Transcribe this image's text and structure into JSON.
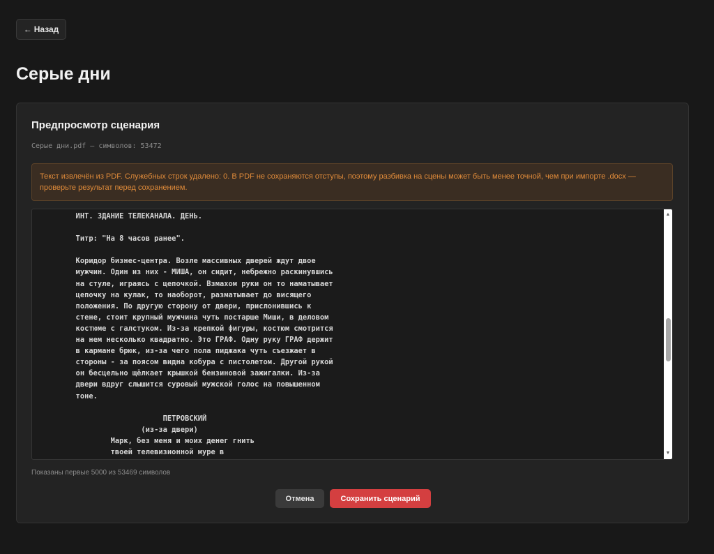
{
  "nav": {
    "back_arrow": "←",
    "back_label": "Назад",
    "back_icon": "arrow-left-icon"
  },
  "page": {
    "title": "Серые дни"
  },
  "preview": {
    "title": "Предпросмотр сценария",
    "file_info": "Серые дни.pdf — символов: 53472",
    "warning": "Текст извлечён из PDF. Служебных строк удалено: 0. В PDF не сохраняются отступы, поэтому разбивка на сцены может быть менее точной, чем при импорте .docx — проверьте результат перед сохранением.",
    "text": "          ИНТ. ЗДАНИЕ ТЕЛЕКАНАЛА. ДЕНЬ.\n\n          Титр: \"На 8 часов ранее\".\n\n          Коридор бизнес-центра. Возле массивных дверей ждут двое\n          мужчин. Один из них - МИША, он сидит, небрежно раскинувшись\n          на стуле, играясь с цепочкой. Взмахом руки он то наматывает\n          цепочку на кулак, то наоборот, разматывает до висящего\n          положения. По другую сторону от двери, прислонившись к\n          стене, стоит крупный мужчина чуть постарше Миши, в деловом\n          костюме с галстуком. Из-за крепкой фигуры, костюм смотрится\n          на нем несколько квадратно. Это ГРАФ. Одну руку ГРАФ держит\n          в кармане брюк, из-за чего пола пиджака чуть съезжает в\n          стороны - за поясом видна кобура с пистолетом. Другой рукой\n          он бесцельно щёлкает крышкой бензиновой зажигалки. Из-за\n          двери вдруг слышится суровый мужской голос на повышенном\n          тоне.\n\n                              ПЕТРОВСКИЙ\n                         (из-за двери)\n                  Марк, без меня и моих денег гнить\n                  твоей телевизионной муре в\n                  Подмосковье",
    "scroll_up": "▲",
    "scroll_down": "▼",
    "shown_count": "Показаны первые 5000 из 53469 символов"
  },
  "actions": {
    "cancel_label": "Отмена",
    "save_label": "Сохранить сценарий"
  },
  "colors": {
    "background": "#181818",
    "card": "#232323",
    "warning_text": "#e08b3a",
    "warning_bg": "#3a2d22",
    "primary": "#d43f40"
  }
}
